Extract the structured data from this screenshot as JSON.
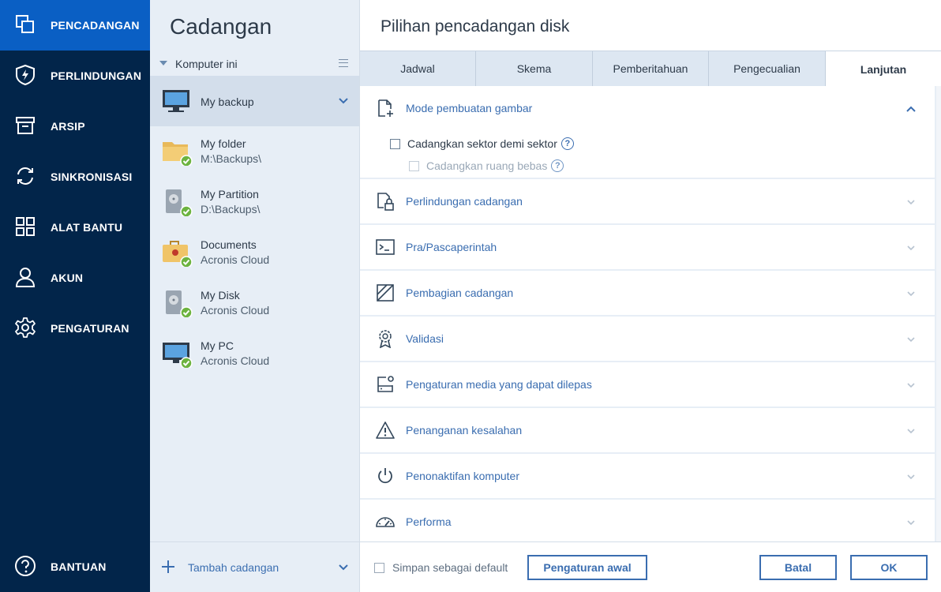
{
  "nav": {
    "items": [
      {
        "label": "PENCADANGAN",
        "icon": "backup-copy-icon",
        "active": true
      },
      {
        "label": "PERLINDUNGAN",
        "icon": "shield-icon"
      },
      {
        "label": "ARSIP",
        "icon": "archive-box-icon"
      },
      {
        "label": "SINKRONISASI",
        "icon": "sync-icon"
      },
      {
        "label": "ALAT BANTU",
        "icon": "tools-grid-icon"
      },
      {
        "label": "AKUN",
        "icon": "account-icon"
      },
      {
        "label": "PENGATURAN",
        "icon": "gear-icon"
      }
    ],
    "help_label": "BANTUAN",
    "active_color": "#0a5fc4",
    "background": "#02254a"
  },
  "backups": {
    "title": "Cadangan",
    "group_label": "Komputer ini",
    "items": [
      {
        "name": "My backup",
        "sub": "",
        "icon": "monitor-icon",
        "selected": true
      },
      {
        "name": "My folder",
        "sub": "M:\\Backups\\",
        "icon": "folder-icon",
        "status": "ok"
      },
      {
        "name": "My Partition",
        "sub": "D:\\Backups\\",
        "icon": "hard-disk-icon",
        "status": "ok"
      },
      {
        "name": "Documents",
        "sub": "Acronis Cloud",
        "icon": "briefcase-icon",
        "status": "ok"
      },
      {
        "name": "My Disk",
        "sub": "Acronis Cloud",
        "icon": "hard-disk-icon",
        "status": "ok"
      },
      {
        "name": "My PC",
        "sub": "Acronis Cloud",
        "icon": "monitor-icon",
        "status": "ok"
      }
    ],
    "add_label": "Tambah cadangan"
  },
  "main": {
    "title": "Pilihan pencadangan disk",
    "tabs": [
      {
        "label": "Jadwal"
      },
      {
        "label": "Skema"
      },
      {
        "label": "Pemberitahuan"
      },
      {
        "label": "Pengecualian"
      },
      {
        "label": "Lanjutan",
        "active": true
      }
    ],
    "sections": [
      {
        "title": "Mode pembuatan gambar",
        "icon": "file-plus-icon",
        "expanded": true
      },
      {
        "title": "Perlindungan cadangan",
        "icon": "lock-file-icon"
      },
      {
        "title": "Pra/Pascaperintah",
        "icon": "terminal-icon"
      },
      {
        "title": "Pembagian cadangan",
        "icon": "split-icon"
      },
      {
        "title": "Validasi",
        "icon": "badge-icon"
      },
      {
        "title": "Pengaturan media yang dapat dilepas",
        "icon": "removable-media-icon"
      },
      {
        "title": "Penanganan kesalahan",
        "icon": "warning-icon"
      },
      {
        "title": "Penonaktifan komputer",
        "icon": "power-icon"
      },
      {
        "title": "Performa",
        "icon": "gauge-icon"
      }
    ],
    "options": {
      "sector_by_sector": {
        "label": "Cadangkan sektor demi sektor",
        "checked": false
      },
      "free_space": {
        "label": "Cadangkan ruang bebas",
        "checked": false,
        "disabled": true
      }
    }
  },
  "footer": {
    "default_label": "Simpan sebagai default",
    "default_checked": false,
    "reset_label": "Pengaturan awal",
    "cancel_label": "Batal",
    "ok_label": "OK"
  }
}
